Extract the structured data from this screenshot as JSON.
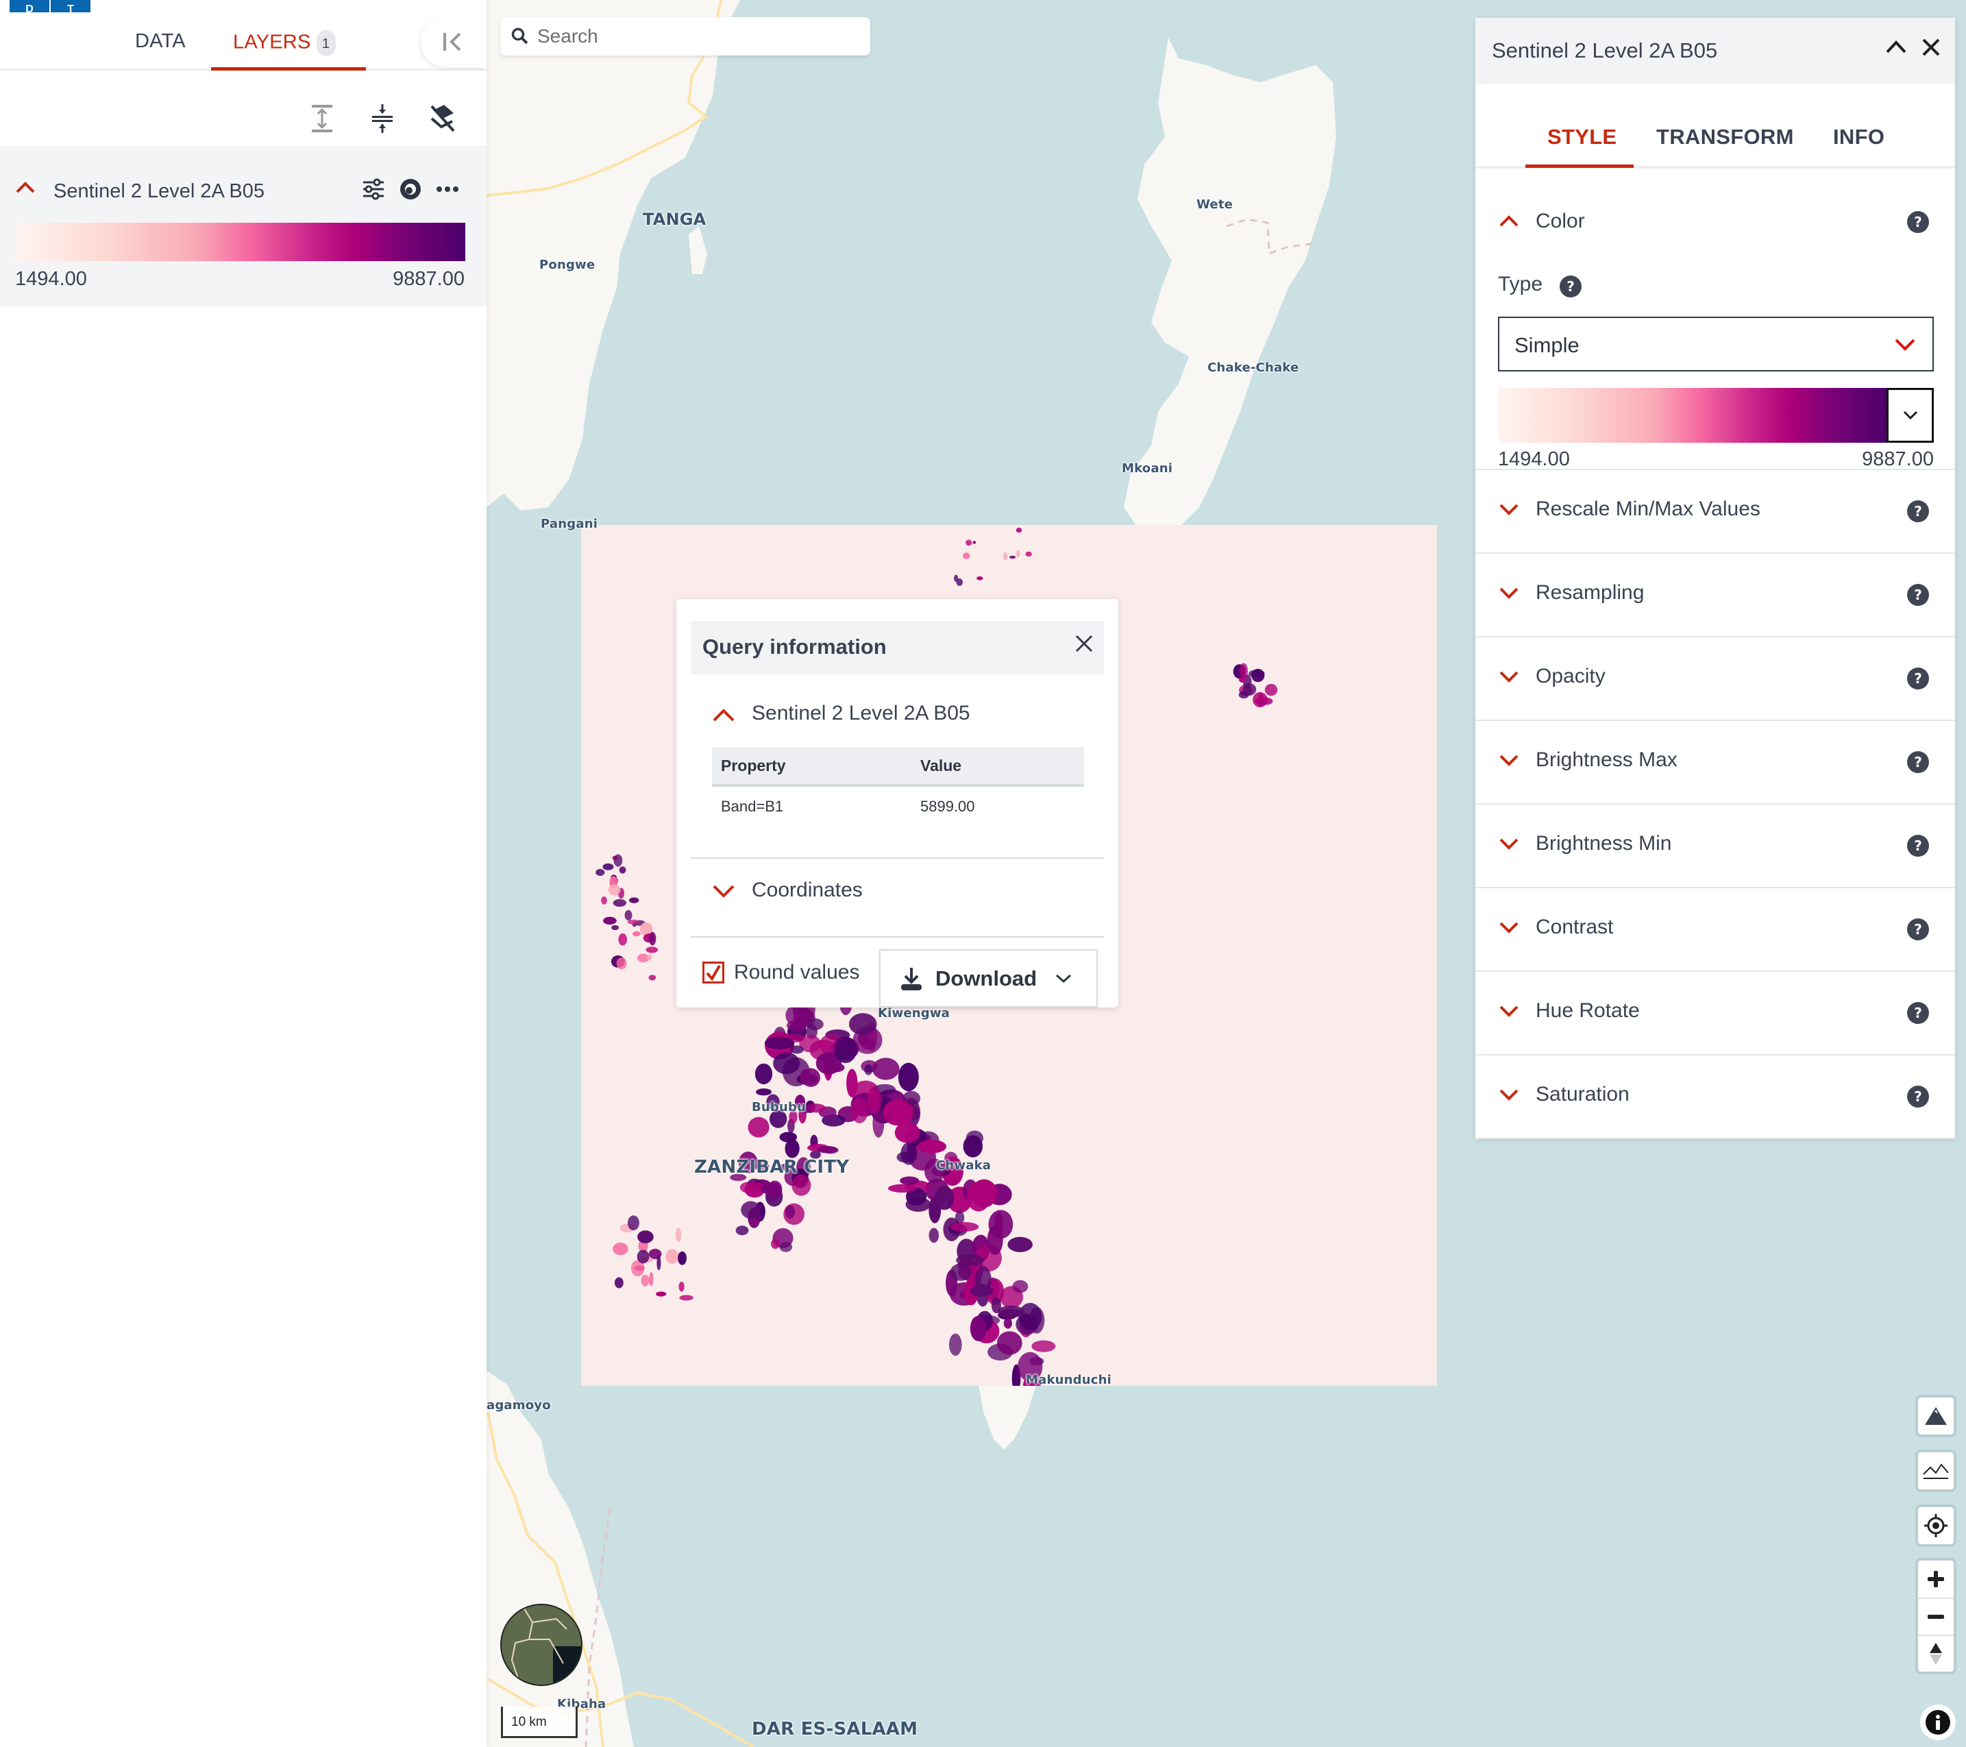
{
  "app": {
    "logo_letters": [
      "D",
      "T"
    ]
  },
  "left_panel": {
    "tabs": [
      {
        "label": "DATA",
        "active": false
      },
      {
        "label": "LAYERS",
        "active": true,
        "badge": "1"
      }
    ],
    "collapse_icon": "collapse-left-icon",
    "tools": [
      {
        "name": "expand-all-icon",
        "enabled": false
      },
      {
        "name": "collapse-all-icon",
        "enabled": true
      },
      {
        "name": "remove-all-layers-icon",
        "enabled": true
      }
    ],
    "layer": {
      "name": "Sentinel 2 Level 2A B05",
      "expanded": true,
      "actions": [
        "settings-sliders-icon",
        "visibility-eye-icon",
        "more-options-icon"
      ],
      "legend_min": "1494.00",
      "legend_max": "9887.00"
    }
  },
  "search": {
    "placeholder": "Search",
    "value": ""
  },
  "right_panel": {
    "title": "Sentinel 2 Level 2A B05",
    "tabs": [
      {
        "label": "STYLE",
        "active": true
      },
      {
        "label": "TRANSFORM",
        "active": false
      },
      {
        "label": "INFO",
        "active": false
      }
    ],
    "color": {
      "label": "Color",
      "expanded": true,
      "type_label": "Type",
      "type_value": "Simple",
      "range_min": "1494.00",
      "range_max": "9887.00"
    },
    "sections": [
      {
        "label": "Rescale Min/Max Values"
      },
      {
        "label": "Resampling"
      },
      {
        "label": "Opacity"
      },
      {
        "label": "Brightness Max"
      },
      {
        "label": "Brightness Min"
      },
      {
        "label": "Contrast"
      },
      {
        "label": "Hue Rotate"
      },
      {
        "label": "Saturation"
      }
    ]
  },
  "query_popup": {
    "title": "Query information",
    "layer_name": "Sentinel 2 Level 2A B05",
    "table": {
      "headers": [
        "Property",
        "Value"
      ],
      "rows": [
        [
          "Band=B1",
          "5899.00"
        ]
      ]
    },
    "coordinates_label": "Coordinates",
    "round_values_label": "Round values",
    "round_values_checked": true,
    "download_label": "Download"
  },
  "map": {
    "labels": [
      {
        "text": "TANGA",
        "kind": "city"
      },
      {
        "text": "Pongwe",
        "kind": "town"
      },
      {
        "text": "Pangani",
        "kind": "town"
      },
      {
        "text": "Wete",
        "kind": "town"
      },
      {
        "text": "Chake-Chake",
        "kind": "town"
      },
      {
        "text": "Mkoani",
        "kind": "town"
      },
      {
        "text": "Kiwengwa",
        "kind": "town"
      },
      {
        "text": "Bububu",
        "kind": "town"
      },
      {
        "text": "ZANZIBAR CITY",
        "kind": "big"
      },
      {
        "text": "Chwaka",
        "kind": "town"
      },
      {
        "text": "Makunduchi",
        "kind": "town"
      },
      {
        "text": "agamoyo",
        "kind": "town"
      },
      {
        "text": "Kibaha",
        "kind": "town"
      },
      {
        "text": "DAR ES-SALAAM",
        "kind": "big"
      }
    ],
    "scale_label": "10 km",
    "controls": [
      "terrain-3d-icon",
      "terrain-2d-icon",
      "locate-icon",
      "zoom-in-icon",
      "zoom-out-icon",
      "compass-icon"
    ],
    "colors": {
      "water": "#cbe0e3",
      "land": "#f9f7f3",
      "road": "#fde3a8",
      "accent": "#c6290f"
    }
  }
}
